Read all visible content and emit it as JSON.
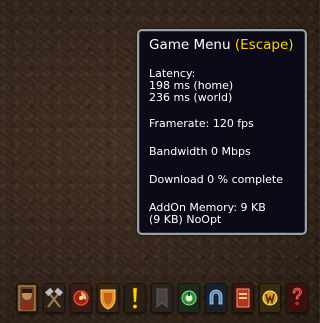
{
  "game_menu_tooltip": {
    "title": "Game Menu",
    "shortcut": "(Escape)",
    "latency_label": "Latency:",
    "latency_home": "198 ms (home)",
    "latency_world": "236 ms (world)",
    "framerate": "Framerate: 120 fps",
    "bandwidth": "Bandwidth 0 Mbps",
    "download": "Download 0 % complete",
    "addon_memory": "AddOn Memory: 9 KB",
    "addon_detail": "(9 KB) NoOpt"
  },
  "micro_menu": {
    "buttons": [
      {
        "icon": "character-portrait-icon"
      },
      {
        "icon": "crossed-hammers-icon"
      },
      {
        "icon": "talents-swirl-icon"
      },
      {
        "icon": "achievement-shield-icon"
      },
      {
        "icon": "quest-exclamation-icon"
      },
      {
        "icon": "guild-banner-icon"
      },
      {
        "icon": "collections-icon"
      },
      {
        "icon": "group-finder-icon"
      },
      {
        "icon": "adventure-guide-book-icon"
      },
      {
        "icon": "shop-coin-icon"
      },
      {
        "icon": "help-question-icon"
      }
    ]
  },
  "colors": {
    "tooltip_bg": "#08081a",
    "tooltip_border": "#9aa0a8",
    "shortcut_gold": "#ffd100",
    "text_white": "#ffffff"
  }
}
